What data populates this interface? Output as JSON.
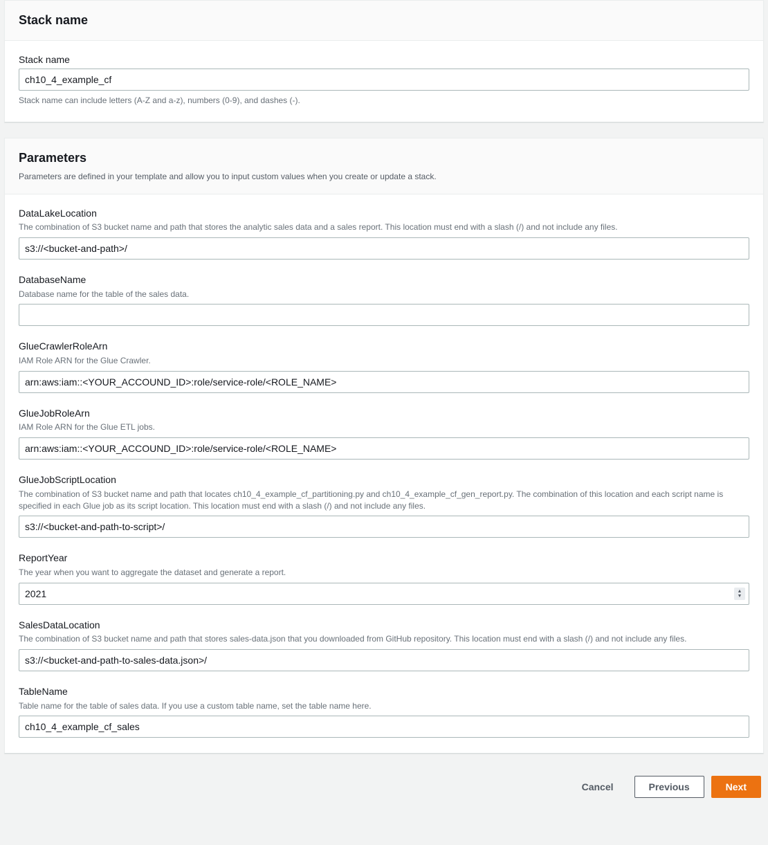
{
  "stack_section": {
    "header": "Stack name",
    "field_label": "Stack name",
    "value": "ch10_4_example_cf",
    "help": "Stack name can include letters (A-Z and a-z), numbers (0-9), and dashes (-)."
  },
  "params_section": {
    "header": "Parameters",
    "desc": "Parameters are defined in your template and allow you to input custom values when you create or update a stack.",
    "fields": {
      "DataLakeLocation": {
        "label": "DataLakeLocation",
        "desc": "The combination of S3 bucket name and path that stores the analytic sales data and a sales report. This location must end with a slash (/) and not include any files.",
        "value": "s3://<bucket-and-path>/"
      },
      "DatabaseName": {
        "label": "DatabaseName",
        "desc": "Database name for the table of the sales data.",
        "value": ""
      },
      "GlueCrawlerRoleArn": {
        "label": "GlueCrawlerRoleArn",
        "desc": "IAM Role ARN for the Glue Crawler.",
        "value": "arn:aws:iam::<YOUR_ACCOUND_ID>:role/service-role/<ROLE_NAME>"
      },
      "GlueJobRoleArn": {
        "label": "GlueJobRoleArn",
        "desc": "IAM Role ARN for the Glue ETL jobs.",
        "value": "arn:aws:iam::<YOUR_ACCOUND_ID>:role/service-role/<ROLE_NAME>"
      },
      "GlueJobScriptLocation": {
        "label": "GlueJobScriptLocation",
        "desc": "The combination of S3 bucket name and path that locates ch10_4_example_cf_partitioning.py and ch10_4_example_cf_gen_report.py. The combination of this location and each script name is specified in each Glue job as its script location. This location must end with a slash (/) and not include any files.",
        "value": "s3://<bucket-and-path-to-script>/"
      },
      "ReportYear": {
        "label": "ReportYear",
        "desc": "The year when you want to aggregate the dataset and generate a report.",
        "value": "2021"
      },
      "SalesDataLocation": {
        "label": "SalesDataLocation",
        "desc": "The combination of S3 bucket name and path that stores sales-data.json that you downloaded from GitHub repository. This location must end with a slash (/) and not include any files.",
        "value": "s3://<bucket-and-path-to-sales-data.json>/"
      },
      "TableName": {
        "label": "TableName",
        "desc": "Table name for the table of sales data. If you use a custom table name, set the table name here.",
        "value": "ch10_4_example_cf_sales"
      }
    }
  },
  "footer": {
    "cancel": "Cancel",
    "previous": "Previous",
    "next": "Next"
  }
}
